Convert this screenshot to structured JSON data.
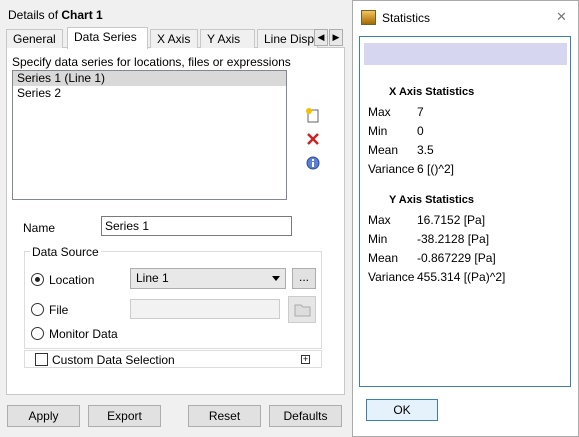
{
  "left_panel": {
    "details_prefix": "Details of ",
    "chart_name": "Chart 1",
    "tabs": [
      {
        "label": "General"
      },
      {
        "label": "Data Series"
      },
      {
        "label": "X Axis"
      },
      {
        "label": "Y Axis"
      },
      {
        "label": "Line Displa"
      }
    ],
    "specify_label": "Specify data series for locations, files or expressions",
    "series": [
      {
        "label": "Series 1 (Line 1)",
        "selected": true
      },
      {
        "label": "Series 2",
        "selected": false
      }
    ],
    "side_icons": [
      "add-series-icon",
      "delete-series-icon",
      "info-icon"
    ],
    "name_label": "Name",
    "name_value": "Series 1",
    "data_source": {
      "title": "Data Source",
      "location_label": "Location",
      "location_value": "Line 1",
      "location_selected": true,
      "dots_label": "...",
      "file_label": "File",
      "monitor_label": "Monitor Data"
    },
    "custom_selection_label": "Custom Data Selection",
    "buttons": {
      "apply": "Apply",
      "export": "Export",
      "reset": "Reset",
      "defaults": "Defaults"
    }
  },
  "statistics": {
    "title": "Statistics",
    "close": "✕",
    "x_axis": {
      "title": "X Axis Statistics",
      "rows": [
        {
          "k": "Max",
          "v": "7"
        },
        {
          "k": "Min",
          "v": "0"
        },
        {
          "k": "Mean",
          "v": "3.5"
        },
        {
          "k": "Variance",
          "v": "6 [()^2]"
        }
      ]
    },
    "y_axis": {
      "title": "Y Axis Statistics",
      "rows": [
        {
          "k": "Max",
          "v": "16.7152 [Pa]"
        },
        {
          "k": "Min",
          "v": "-38.2128 [Pa]"
        },
        {
          "k": "Mean",
          "v": "-0.867229 [Pa]"
        },
        {
          "k": "Variance",
          "v": "455.314 [(Pa)^2]"
        }
      ]
    },
    "ok_label": "OK"
  },
  "colors": {
    "accent_border": "#3c7fb1",
    "header_bar": "#d6d6f0",
    "delete_icon": "#cc2222"
  }
}
